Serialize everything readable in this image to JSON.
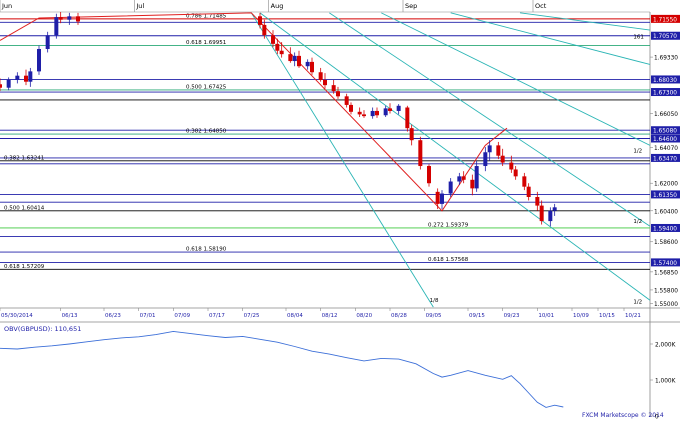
{
  "chart_data": [
    {
      "type": "candlestick",
      "title": "",
      "months": [
        {
          "label": "Jun",
          "day": 0
        },
        {
          "label": "Jul",
          "day": 31
        },
        {
          "label": "Aug",
          "day": 62
        },
        {
          "label": "Sep",
          "day": 93
        },
        {
          "label": "Oct",
          "day": 123
        }
      ],
      "date_ticks": [
        "05/30/2014",
        "06/13",
        "06/23",
        "07/01",
        "07/09",
        "07/17",
        "07/25",
        "08/04",
        "08/12",
        "08/20",
        "08/28",
        "09/05",
        "09/15",
        "09/23",
        "10/01",
        "10/09",
        "10/15",
        "10/21"
      ],
      "date_tick_days": [
        0,
        14,
        24,
        32,
        40,
        48,
        56,
        66,
        74,
        82,
        90,
        98,
        108,
        116,
        124,
        132,
        138,
        144
      ],
      "price_axis": {
        "ylim": [
          1.5475,
          1.7195
        ],
        "labels": [
          {
            "v": 1.7155,
            "t": "1.71550",
            "boxed": true,
            "color": "#d40000"
          },
          {
            "v": 1.7057,
            "t": "1.70570",
            "boxed": true,
            "color": "#1f1fa8"
          },
          {
            "v": 1.6933,
            "t": "1.69330",
            "boxed": false,
            "color": "#000000"
          },
          {
            "v": 1.6803,
            "t": "1.68030",
            "boxed": true,
            "color": "#1f1fa8"
          },
          {
            "v": 1.673,
            "t": "1.67300",
            "boxed": true,
            "color": "#1f1fa8"
          },
          {
            "v": 1.6605,
            "t": "1.66050",
            "boxed": false,
            "color": "#000000"
          },
          {
            "v": 1.6508,
            "t": "1.65080",
            "boxed": true,
            "color": "#1f1fa8"
          },
          {
            "v": 1.646,
            "t": "1.64600",
            "boxed": true,
            "color": "#1f1fa8"
          },
          {
            "v": 1.6407,
            "t": "1.64070",
            "boxed": false,
            "color": "#000000"
          },
          {
            "v": 1.6347,
            "t": "1.63470",
            "boxed": true,
            "color": "#1f1fa8"
          },
          {
            "v": 1.62,
            "t": "1.62000",
            "boxed": false,
            "color": "#000000"
          },
          {
            "v": 1.6135,
            "t": "1.61350",
            "boxed": true,
            "color": "#1f1fa8"
          },
          {
            "v": 1.604,
            "t": "1.60400",
            "boxed": false,
            "color": "#000000"
          },
          {
            "v": 1.594,
            "t": "1.59400",
            "boxed": true,
            "color": "#1f1fa8"
          },
          {
            "v": 1.586,
            "t": "1.58600",
            "boxed": false,
            "color": "#000000"
          },
          {
            "v": 1.574,
            "t": "1.57400",
            "boxed": true,
            "color": "#1f1fa8"
          },
          {
            "v": 1.5685,
            "t": "1.56850",
            "boxed": false,
            "color": "#000000"
          },
          {
            "v": 1.558,
            "t": "1.55800",
            "boxed": false,
            "color": "#000000"
          },
          {
            "v": 1.55,
            "t": "1.55000",
            "boxed": false,
            "color": "#000000"
          }
        ]
      },
      "levels": [
        {
          "v": 1.7155,
          "color": "#d40000",
          "label": "0.786 1.71485"
        },
        {
          "v": 1.7135,
          "color": "#1f1fa8",
          "label": ""
        },
        {
          "v": 1.7057,
          "color": "#1f1fa8",
          "label": ""
        },
        {
          "v": 1.7,
          "color": "#2aa876",
          "label": "0.618 1.69951"
        },
        {
          "v": 1.6803,
          "color": "#1f1fa8",
          "label": ""
        },
        {
          "v": 1.6742,
          "color": "#2aa876",
          "label": "0.500 1.67425"
        },
        {
          "v": 1.673,
          "color": "#1f1fa8",
          "label": ""
        },
        {
          "v": 1.6684,
          "color": "#000000",
          "label": ""
        },
        {
          "v": 1.6508,
          "color": "#1f1fa8",
          "label": ""
        },
        {
          "v": 1.6486,
          "color": "#2aa876",
          "label": "0.382 1.64850"
        },
        {
          "v": 1.646,
          "color": "#1f1fa8",
          "label": ""
        },
        {
          "v": 1.6347,
          "color": "#1f1fa8",
          "label": ""
        },
        {
          "v": 1.633,
          "color": "#000000",
          "label": "0.382 1.63241"
        },
        {
          "v": 1.6313,
          "color": "#1f1fa8",
          "label": ""
        },
        {
          "v": 1.6135,
          "color": "#1f1fa8",
          "label": ""
        },
        {
          "v": 1.609,
          "color": "#1f1fa8",
          "label": ""
        },
        {
          "v": 1.604,
          "color": "#000000",
          "label": "0.500 1.60414"
        },
        {
          "v": 1.594,
          "color": "#3ec93e",
          "label": "0.272 1.59379"
        },
        {
          "v": 1.589,
          "color": "#1f1fa8",
          "label": ""
        },
        {
          "v": 1.58,
          "color": "#1f1fa8",
          "label": "0.618 1.58190"
        },
        {
          "v": 1.574,
          "color": "#1f1fa8",
          "label": "0.618 1.57568"
        },
        {
          "v": 1.57,
          "color": "#000000",
          "label": "0.618 1.57209"
        }
      ],
      "candles": [
        {
          "d": 0,
          "o": 1.6775,
          "h": 1.681,
          "l": 1.6735,
          "c": 1.6755
        },
        {
          "d": 2,
          "o": 1.6755,
          "h": 1.6815,
          "l": 1.674,
          "c": 1.68
        },
        {
          "d": 4,
          "o": 1.68,
          "h": 1.6845,
          "l": 1.678,
          "c": 1.6825
        },
        {
          "d": 6,
          "o": 1.6825,
          "h": 1.686,
          "l": 1.677,
          "c": 1.679
        },
        {
          "d": 7,
          "o": 1.679,
          "h": 1.687,
          "l": 1.676,
          "c": 1.685
        },
        {
          "d": 9,
          "o": 1.685,
          "h": 1.7,
          "l": 1.683,
          "c": 1.698
        },
        {
          "d": 11,
          "o": 1.698,
          "h": 1.708,
          "l": 1.696,
          "c": 1.706
        },
        {
          "d": 13,
          "o": 1.706,
          "h": 1.7185,
          "l": 1.704,
          "c": 1.7165
        },
        {
          "d": 14,
          "o": 1.7165,
          "h": 1.7195,
          "l": 1.713,
          "c": 1.715
        },
        {
          "d": 16,
          "o": 1.715,
          "h": 1.719,
          "l": 1.712,
          "c": 1.717
        },
        {
          "d": 18,
          "o": 1.717,
          "h": 1.719,
          "l": 1.712,
          "c": 1.714
        },
        {
          "d": 60,
          "o": 1.717,
          "h": 1.719,
          "l": 1.71,
          "c": 1.712
        },
        {
          "d": 61,
          "o": 1.712,
          "h": 1.715,
          "l": 1.704,
          "c": 1.706
        },
        {
          "d": 63,
          "o": 1.706,
          "h": 1.709,
          "l": 1.699,
          "c": 1.701
        },
        {
          "d": 64,
          "o": 1.701,
          "h": 1.704,
          "l": 1.695,
          "c": 1.697
        },
        {
          "d": 65,
          "o": 1.697,
          "h": 1.702,
          "l": 1.693,
          "c": 1.695
        },
        {
          "d": 67,
          "o": 1.695,
          "h": 1.699,
          "l": 1.69,
          "c": 1.691
        },
        {
          "d": 68,
          "o": 1.691,
          "h": 1.696,
          "l": 1.688,
          "c": 1.694
        },
        {
          "d": 69,
          "o": 1.694,
          "h": 1.697,
          "l": 1.687,
          "c": 1.688
        },
        {
          "d": 71,
          "o": 1.688,
          "h": 1.692,
          "l": 1.686,
          "c": 1.6905
        },
        {
          "d": 72,
          "o": 1.6905,
          "h": 1.693,
          "l": 1.683,
          "c": 1.6845
        },
        {
          "d": 74,
          "o": 1.6845,
          "h": 1.687,
          "l": 1.679,
          "c": 1.68
        },
        {
          "d": 75,
          "o": 1.68,
          "h": 1.684,
          "l": 1.675,
          "c": 1.677
        },
        {
          "d": 77,
          "o": 1.677,
          "h": 1.68,
          "l": 1.672,
          "c": 1.6735
        },
        {
          "d": 78,
          "o": 1.6735,
          "h": 1.676,
          "l": 1.669,
          "c": 1.6705
        },
        {
          "d": 80,
          "o": 1.6705,
          "h": 1.672,
          "l": 1.664,
          "c": 1.6655
        },
        {
          "d": 81,
          "o": 1.6655,
          "h": 1.667,
          "l": 1.66,
          "c": 1.6615
        },
        {
          "d": 83,
          "o": 1.6615,
          "h": 1.664,
          "l": 1.6585,
          "c": 1.66
        },
        {
          "d": 84,
          "o": 1.66,
          "h": 1.6625,
          "l": 1.658,
          "c": 1.659
        },
        {
          "d": 86,
          "o": 1.659,
          "h": 1.664,
          "l": 1.6575,
          "c": 1.662
        },
        {
          "d": 87,
          "o": 1.662,
          "h": 1.664,
          "l": 1.658,
          "c": 1.6595
        },
        {
          "d": 89,
          "o": 1.6595,
          "h": 1.665,
          "l": 1.6585,
          "c": 1.6635
        },
        {
          "d": 90,
          "o": 1.6635,
          "h": 1.6665,
          "l": 1.6605,
          "c": 1.662
        },
        {
          "d": 92,
          "o": 1.662,
          "h": 1.666,
          "l": 1.66,
          "c": 1.665
        },
        {
          "d": 94,
          "o": 1.664,
          "h": 1.665,
          "l": 1.65,
          "c": 1.652
        },
        {
          "d": 95,
          "o": 1.652,
          "h": 1.654,
          "l": 1.642,
          "c": 1.645
        },
        {
          "d": 97,
          "o": 1.645,
          "h": 1.647,
          "l": 1.628,
          "c": 1.63
        },
        {
          "d": 99,
          "o": 1.63,
          "h": 1.631,
          "l": 1.618,
          "c": 1.62
        },
        {
          "d": 101,
          "o": 1.615,
          "h": 1.617,
          "l": 1.605,
          "c": 1.608
        },
        {
          "d": 102,
          "o": 1.608,
          "h": 1.616,
          "l": 1.605,
          "c": 1.614
        },
        {
          "d": 104,
          "o": 1.614,
          "h": 1.623,
          "l": 1.612,
          "c": 1.621
        },
        {
          "d": 106,
          "o": 1.621,
          "h": 1.626,
          "l": 1.619,
          "c": 1.624
        },
        {
          "d": 107,
          "o": 1.624,
          "h": 1.627,
          "l": 1.62,
          "c": 1.622
        },
        {
          "d": 109,
          "o": 1.622,
          "h": 1.625,
          "l": 1.613,
          "c": 1.617
        },
        {
          "d": 110,
          "o": 1.617,
          "h": 1.633,
          "l": 1.615,
          "c": 1.63
        },
        {
          "d": 112,
          "o": 1.63,
          "h": 1.641,
          "l": 1.627,
          "c": 1.638
        },
        {
          "d": 113,
          "o": 1.638,
          "h": 1.645,
          "l": 1.633,
          "c": 1.642
        },
        {
          "d": 115,
          "o": 1.642,
          "h": 1.644,
          "l": 1.634,
          "c": 1.636
        },
        {
          "d": 116,
          "o": 1.636,
          "h": 1.64,
          "l": 1.63,
          "c": 1.632
        },
        {
          "d": 118,
          "o": 1.632,
          "h": 1.636,
          "l": 1.626,
          "c": 1.628
        },
        {
          "d": 119,
          "o": 1.628,
          "h": 1.63,
          "l": 1.622,
          "c": 1.624
        },
        {
          "d": 121,
          "o": 1.624,
          "h": 1.626,
          "l": 1.616,
          "c": 1.618
        },
        {
          "d": 122,
          "o": 1.618,
          "h": 1.62,
          "l": 1.61,
          "c": 1.612
        },
        {
          "d": 124,
          "o": 1.612,
          "h": 1.615,
          "l": 1.604,
          "c": 1.607
        },
        {
          "d": 125,
          "o": 1.607,
          "h": 1.61,
          "l": 1.596,
          "c": 1.598
        },
        {
          "d": 127,
          "o": 1.598,
          "h": 1.606,
          "l": 1.595,
          "c": 1.604
        },
        {
          "d": 128,
          "o": 1.604,
          "h": 1.608,
          "l": 1.601,
          "c": 1.606
        }
      ],
      "pitchfork_red": [
        {
          "d": 0,
          "v": 1.703
        },
        {
          "d": 9,
          "v": 1.716
        },
        {
          "d": 58,
          "v": 1.719
        },
        {
          "d": 102,
          "v": 1.604
        },
        {
          "d": 112,
          "v": 1.642
        },
        {
          "d": 117,
          "v": 1.652
        }
      ],
      "channel_lines": [
        {
          "d1": 58,
          "v1": 1.719,
          "d2": 100,
          "v2": 1.548
        },
        {
          "d1": 60,
          "v1": 1.719,
          "d2": 150,
          "v2": 1.552
        },
        {
          "d1": 76,
          "v1": 1.719,
          "d2": 150,
          "v2": 1.595
        },
        {
          "d1": 88,
          "v1": 1.719,
          "d2": 150,
          "v2": 1.642
        },
        {
          "d1": 104,
          "v1": 1.719,
          "d2": 150,
          "v2": 1.689
        },
        {
          "d1": 120,
          "v1": 1.719,
          "d2": 150,
          "v2": 1.709
        }
      ],
      "annotations": [
        {
          "d": 148,
          "v": 1.704,
          "t": "161"
        },
        {
          "d": 148,
          "v": 1.638,
          "t": "1/2"
        },
        {
          "d": 148,
          "v": 1.597,
          "t": "1/2"
        },
        {
          "d": 148,
          "v": 1.55,
          "t": "1/2"
        },
        {
          "d": 101,
          "v": 1.551,
          "t": "1/8"
        }
      ]
    },
    {
      "type": "line",
      "title": "OBV(GBPUSD): 110,651",
      "series": [
        {
          "name": "OBV(GBPUSD): 110,651",
          "values": [
            {
              "d": 0,
              "v": 1880
            },
            {
              "d": 4,
              "v": 1860
            },
            {
              "d": 8,
              "v": 1910
            },
            {
              "d": 12,
              "v": 1950
            },
            {
              "d": 16,
              "v": 2000
            },
            {
              "d": 20,
              "v": 2060
            },
            {
              "d": 24,
              "v": 2120
            },
            {
              "d": 28,
              "v": 2170
            },
            {
              "d": 32,
              "v": 2200
            },
            {
              "d": 36,
              "v": 2260
            },
            {
              "d": 40,
              "v": 2350
            },
            {
              "d": 44,
              "v": 2290
            },
            {
              "d": 48,
              "v": 2230
            },
            {
              "d": 52,
              "v": 2180
            },
            {
              "d": 56,
              "v": 2210
            },
            {
              "d": 60,
              "v": 2130
            },
            {
              "d": 64,
              "v": 2050
            },
            {
              "d": 68,
              "v": 1930
            },
            {
              "d": 72,
              "v": 1800
            },
            {
              "d": 76,
              "v": 1720
            },
            {
              "d": 80,
              "v": 1620
            },
            {
              "d": 84,
              "v": 1530
            },
            {
              "d": 88,
              "v": 1600
            },
            {
              "d": 92,
              "v": 1580
            },
            {
              "d": 96,
              "v": 1450
            },
            {
              "d": 100,
              "v": 1180
            },
            {
              "d": 102,
              "v": 1080
            },
            {
              "d": 104,
              "v": 1130
            },
            {
              "d": 108,
              "v": 1260
            },
            {
              "d": 112,
              "v": 1130
            },
            {
              "d": 116,
              "v": 1020
            },
            {
              "d": 118,
              "v": 1120
            },
            {
              "d": 120,
              "v": 900
            },
            {
              "d": 122,
              "v": 640
            },
            {
              "d": 124,
              "v": 380
            },
            {
              "d": 126,
              "v": 240
            },
            {
              "d": 128,
              "v": 300
            },
            {
              "d": 130,
              "v": 250
            }
          ]
        }
      ],
      "ylim": [
        0,
        2500
      ],
      "y_ticks": [
        {
          "v": 2000,
          "t": "2,000K"
        },
        {
          "v": 1000,
          "t": "1,000K"
        },
        {
          "v": 0,
          "t": "0"
        }
      ],
      "credit": "FXCM Marketscope © 2014"
    }
  ]
}
